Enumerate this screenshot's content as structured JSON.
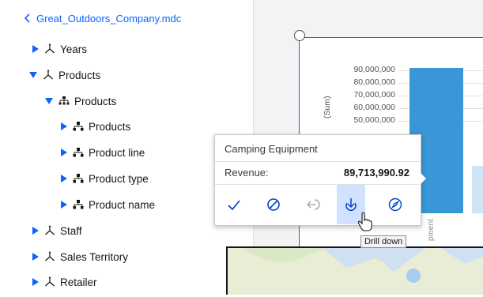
{
  "source_panel": {
    "back_label": "Great_Outdoors_Company.mdc",
    "items": [
      {
        "label": "Years",
        "expanded": false,
        "icon": "dimension-icon"
      },
      {
        "label": "Products",
        "expanded": true,
        "icon": "dimension-icon"
      },
      {
        "label": "Products",
        "expanded": true,
        "icon": "hierarchy-icon"
      },
      {
        "label": "Products",
        "expanded": false,
        "icon": "level-icon"
      },
      {
        "label": "Product line",
        "expanded": false,
        "icon": "level-icon"
      },
      {
        "label": "Product type",
        "expanded": false,
        "icon": "level-icon"
      },
      {
        "label": "Product name",
        "expanded": false,
        "icon": "level-icon"
      },
      {
        "label": "Staff",
        "expanded": false,
        "icon": "dimension-icon"
      },
      {
        "label": "Sales Territory",
        "expanded": false,
        "icon": "dimension-icon"
      },
      {
        "label": "Retailer",
        "expanded": false,
        "icon": "dimension-icon"
      }
    ]
  },
  "chart": {
    "y_ticks": [
      "90,000,000",
      "80,000,000",
      "70,000,000",
      "60,000,000",
      "50,000,000"
    ],
    "y_axis_label": "(Sum)",
    "x_label": "pment",
    "bar_color": "#3a96d6"
  },
  "popover": {
    "title": "Camping Equipment",
    "row_label": "Revenue:",
    "row_value": "89,713,990.92",
    "actions": [
      "check-icon",
      "exclude-icon",
      "drill-up-icon",
      "drill-down-icon",
      "compass-icon"
    ],
    "tooltip": "Drill down"
  },
  "colors": {
    "accent": "#0f62fe",
    "icon_blue": "#0043ce",
    "active": "#d0e2ff"
  }
}
